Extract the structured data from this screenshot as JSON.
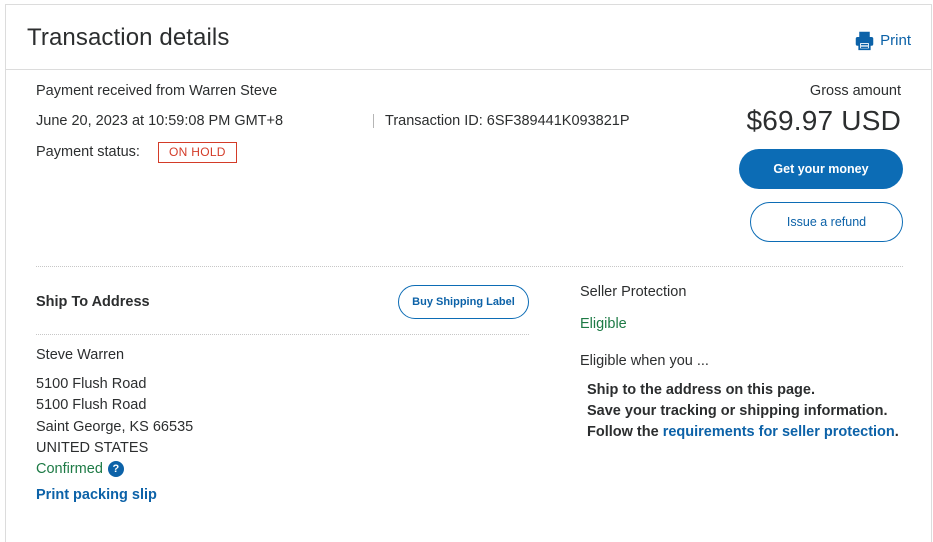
{
  "header": {
    "title": "Transaction details",
    "print_label": "Print"
  },
  "transaction": {
    "received_from": "Payment received from Warren Steve",
    "datetime": "June 20, 2023 at 10:59:08 PM GMT+8",
    "transaction_id": "Transaction ID: 6SF389441K093821P",
    "status_label": "Payment status:",
    "status_value": "ON HOLD"
  },
  "amount": {
    "label": "Gross amount",
    "value": "$69.97 USD"
  },
  "actions": {
    "get_money": "Get your money",
    "issue_refund": "Issue a refund"
  },
  "shipping": {
    "title": "Ship To Address",
    "buy_label": "Buy Shipping Label",
    "name": "Steve Warren",
    "address_lines": [
      "5100 Flush Road",
      "5100 Flush Road",
      "Saint George, KS 66535",
      "UNITED STATES"
    ],
    "confirmed": "Confirmed",
    "help": "?",
    "print_slip": "Print packing slip"
  },
  "seller_protection": {
    "title": "Seller Protection",
    "status": "Eligible",
    "when_label": "Eligible when you ...",
    "req1": "Ship to the address on this page.",
    "req2": "Save your tracking or shipping information.",
    "req3_prefix": "Follow the ",
    "req3_link": "requirements for seller protection",
    "req3_suffix": "."
  },
  "colors": {
    "brand_blue": "#0c6cb5",
    "link_blue": "#0c62a8",
    "hold_red": "#d33b28",
    "eligible_green": "#1d7a45"
  }
}
